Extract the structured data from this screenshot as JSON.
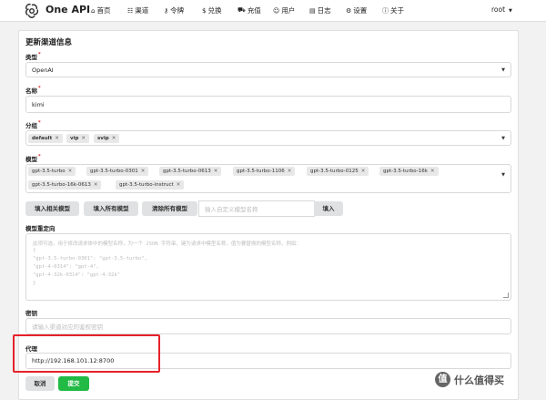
{
  "header": {
    "brand": "One API",
    "nav": [
      {
        "icon": "home-icon",
        "glyph": "⌂",
        "label": "首页"
      },
      {
        "icon": "sitemap-icon",
        "glyph": "☷",
        "label": "渠道"
      },
      {
        "icon": "key-icon",
        "glyph": "⚷",
        "label": "令牌"
      },
      {
        "icon": "dollar-icon",
        "glyph": "$",
        "label": "兑换"
      },
      {
        "icon": "cart-icon",
        "glyph": "⛟",
        "label": "充值"
      },
      {
        "icon": "users-icon",
        "glyph": "☺",
        "label": "用户"
      },
      {
        "icon": "book-icon",
        "glyph": "▤",
        "label": "日志"
      },
      {
        "icon": "gear-icon",
        "glyph": "⚙",
        "label": "设置"
      },
      {
        "icon": "info-icon",
        "glyph": "ⓘ",
        "label": "关于"
      }
    ],
    "user": "root"
  },
  "form": {
    "title": "更新渠道信息",
    "type": {
      "label": "类型",
      "value": "OpenAI"
    },
    "name": {
      "label": "名称",
      "value": "kimi"
    },
    "group": {
      "label": "分组",
      "chips": [
        "default",
        "vip",
        "svip"
      ]
    },
    "models": {
      "label": "模型",
      "chips": [
        "gpt-3.5-turbo",
        "gpt-3.5-turbo-0301",
        "gpt-3.5-turbo-0613",
        "gpt-3.5-turbo-1106",
        "gpt-3.5-turbo-0125",
        "gpt-3.5-turbo-16k",
        "gpt-3.5-turbo-16k-0613",
        "gpt-3.5-turbo-instruct"
      ]
    },
    "model_buttons": {
      "fill_related": "填入相关模型",
      "fill_all": "填入所有模型",
      "clear_all": "清除所有模型",
      "custom_placeholder": "输入自定义模型名称",
      "fill": "填入"
    },
    "model_mapping": {
      "label": "模型重定向",
      "placeholder_lines": [
        "此项可选，用于修改请求体中的模型名称，为一个 JSON 字符串，键为请求中模型名称，值为要替换的模型名称，例如：",
        "{",
        "  \"gpt-3.5-turbo-0301\": \"gpt-3.5-turbo\",",
        "  \"gpt-4-0314\": \"gpt-4\",",
        "  \"gpt-4-32k-0314\": \"gpt-4-32k\"",
        "}"
      ]
    },
    "key": {
      "label": "密钥",
      "placeholder": "请输入渠道对应的鉴权密钥"
    },
    "proxy": {
      "label": "代理",
      "value": "http://192.168.101.12:8700"
    },
    "actions": {
      "cancel": "取消",
      "submit": "提交"
    }
  },
  "watermark": {
    "glyph": "值",
    "text": "什么值得买"
  },
  "colors": {
    "accent_green": "#21ba45",
    "highlight_red": "#e62129",
    "required": "#db2828"
  }
}
